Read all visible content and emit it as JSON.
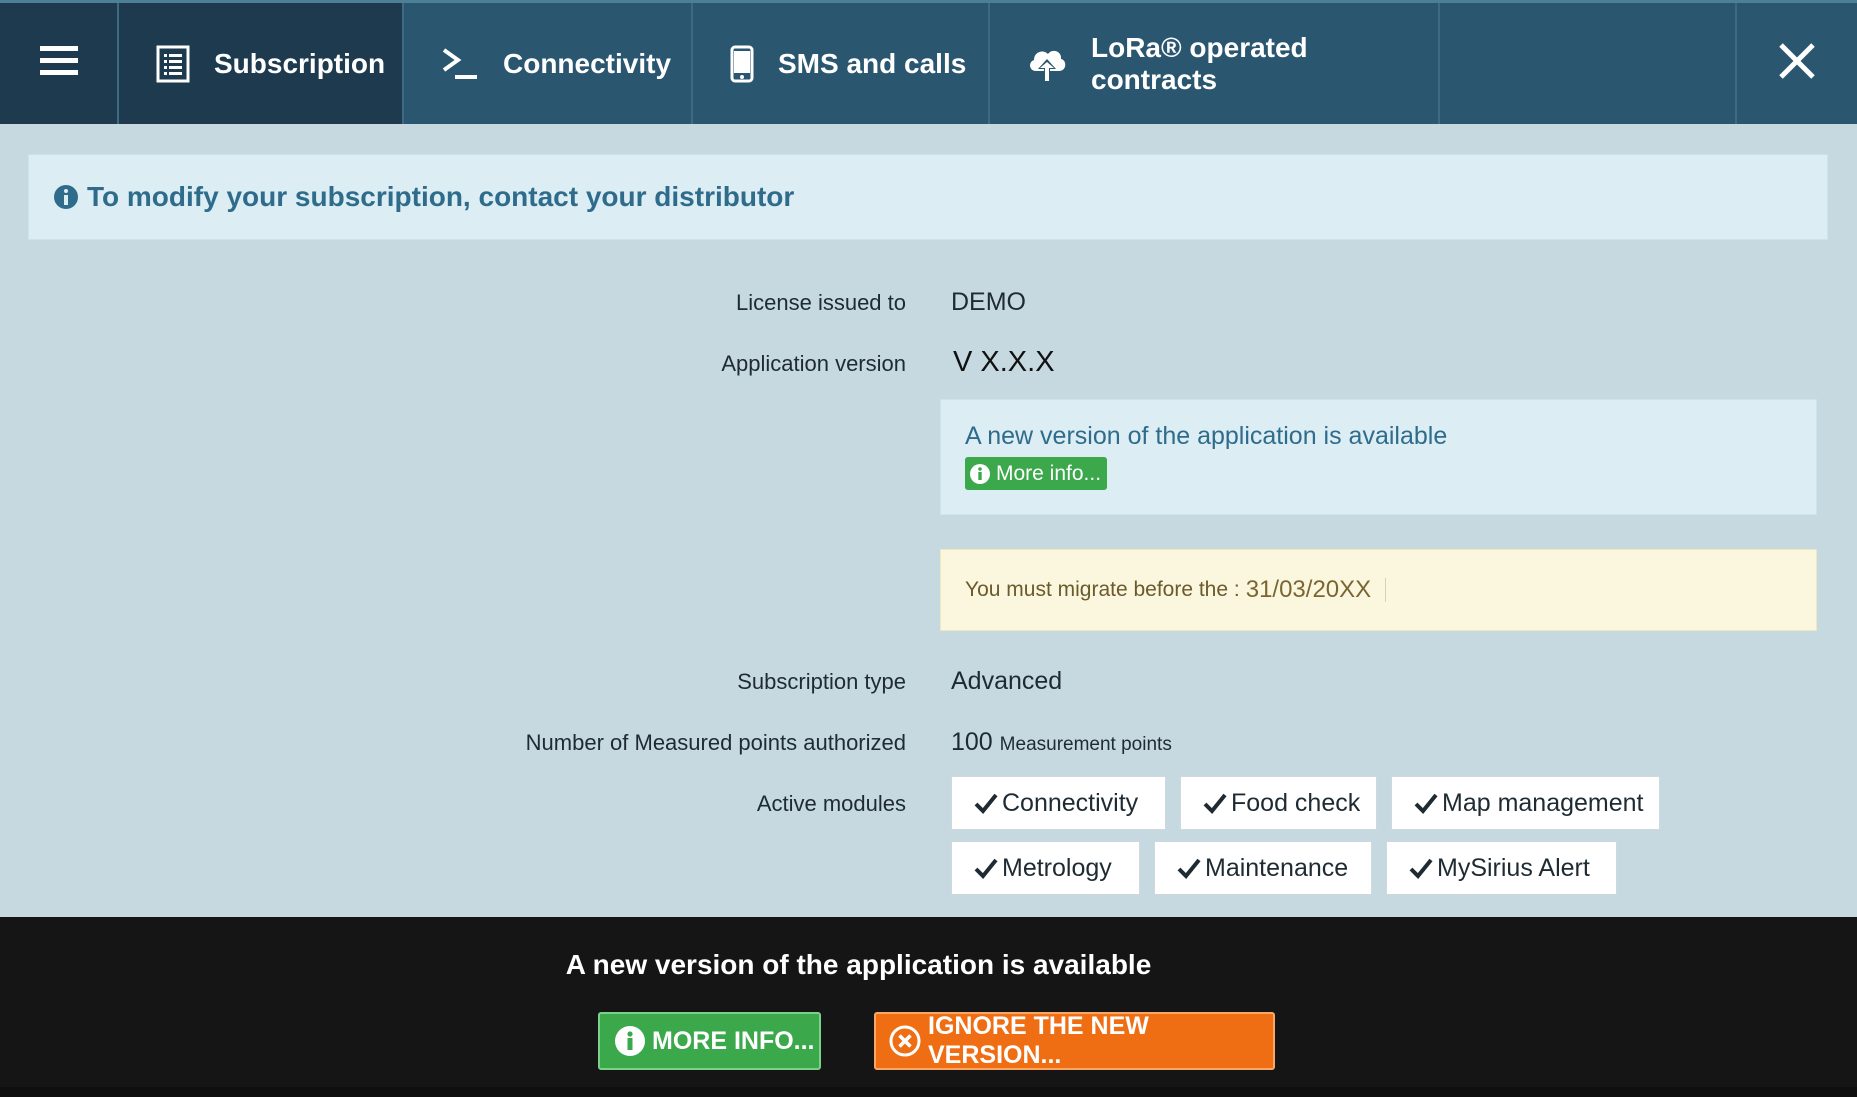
{
  "nav": {
    "menu_icon": "hamburger-icon",
    "tabs": [
      {
        "label": "Subscription",
        "icon": "list-document-icon",
        "active": true
      },
      {
        "label": "Connectivity",
        "icon": "terminal-prompt-icon",
        "active": false
      },
      {
        "label": "SMS and calls",
        "icon": "mobile-phone-icon",
        "active": false
      },
      {
        "label": "LoRa® operated contracts",
        "icon": "cloud-upload-icon",
        "active": false
      }
    ],
    "close_icon": "close-icon"
  },
  "banner": {
    "text": "To modify your subscription, contact your distributor",
    "icon": "info-circle-icon"
  },
  "form": {
    "license_label": "License issued to",
    "license_value": "DEMO",
    "version_label": "Application version",
    "version_value": "V X.X.X",
    "new_version_text": "A new version of the application is available",
    "more_info_label": "More info...",
    "migrate_text": "You must migrate before the :",
    "migrate_date": "31/03/20XX",
    "subscription_label": "Subscription type",
    "subscription_value": "Advanced",
    "points_label": "Number of Measured points authorized",
    "points_value": "100",
    "points_unit": "Measurement points",
    "modules_label": "Active modules",
    "modules": [
      "Connectivity",
      "Food check",
      "Map management",
      "Metrology",
      "Maintenance",
      "MySirius Alert"
    ]
  },
  "notification": {
    "title": "A new version of the application is available",
    "more_label": "MORE INFO...",
    "ignore_label": "IGNORE THE NEW VERSION..."
  },
  "colors": {
    "nav_bg": "#2a5670",
    "nav_active": "#1d3a4f",
    "page_bg": "#c6d9e1",
    "info_bg": "#dcedf4",
    "info_text": "#2f6c8c",
    "warning_bg": "#fbf7de",
    "success": "#3aa84b",
    "danger_orange": "#f06e13",
    "notify_bg": "#151515"
  }
}
